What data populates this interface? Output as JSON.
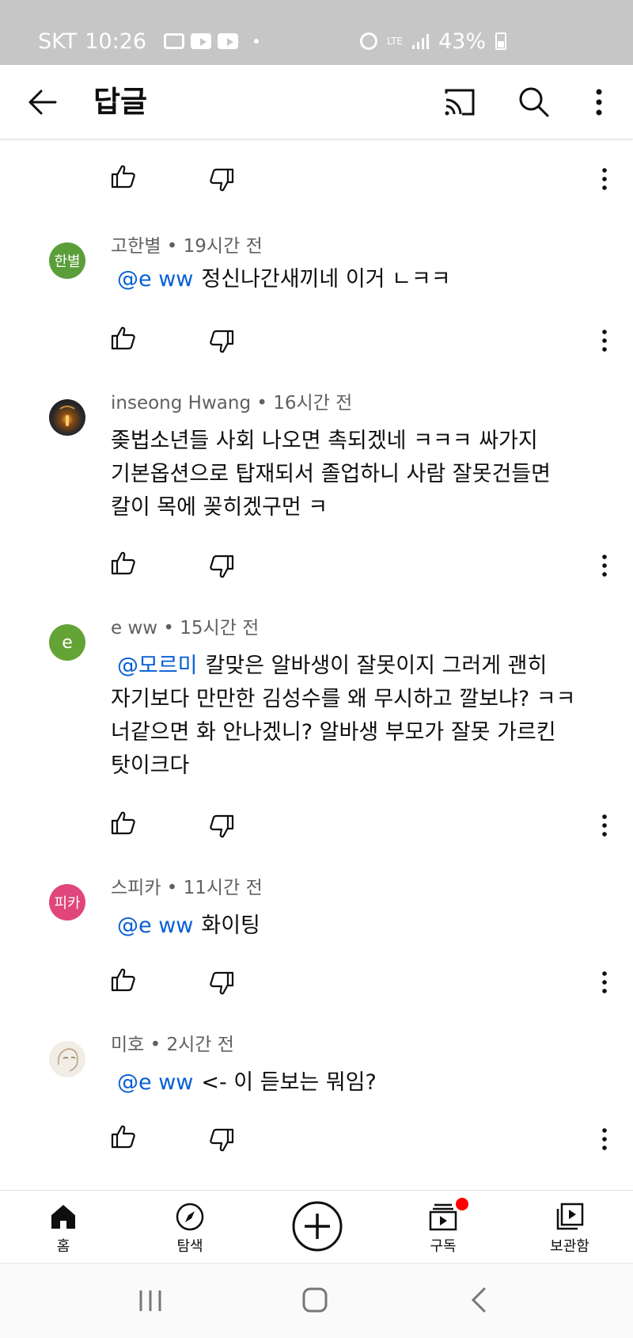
{
  "status_bar": {
    "carrier": "SKT",
    "time": "10:26",
    "network": "LTE",
    "battery": "43%"
  },
  "header": {
    "title": "답글"
  },
  "comments": [
    {
      "avatar_text": "한별",
      "avatar_color": "#5a9e3a",
      "meta": "고한별 • 19시간 전",
      "mention": "@e ww",
      "text": "정신나간새끼네 이거 ㄴㅋㅋ"
    },
    {
      "avatar_text": "",
      "avatar_color": "#2a2a2a",
      "meta": "inseong Hwang • 16시간 전",
      "mention": "",
      "lines": [
        "좆법소년들 사회 나오면 촉되겠네 ㅋㅋㅋ 싸가지",
        "기본옵션으로 탑재되서 졸업하니 사람 잘못건들면",
        "칼이 목에 꽂히겠구먼 ㅋ"
      ]
    },
    {
      "avatar_text": "e",
      "avatar_color": "#64a335",
      "meta": "e ww • 15시간 전",
      "mention": "@모르미",
      "lines": [
        "칼맞은 알바생이 잘못이지 그러게 괜히",
        "자기보다 만만한 김성수를 왜 무시하고 깔보냐? ㅋㅋ",
        "너같으면 화 안나겠니? 알바생 부모가 잘못 가르킨",
        "탓이크다"
      ]
    },
    {
      "avatar_text": "피카",
      "avatar_color": "#e0457b",
      "meta": "스피카 • 11시간 전",
      "mention": "@e ww",
      "text": "화이팅"
    },
    {
      "avatar_text": "",
      "avatar_color": "#f1ede6",
      "meta": "미호 • 2시간 전",
      "mention": "@e ww",
      "text": "<- 이 듣보는 뭐임?"
    }
  ],
  "bottom_nav": {
    "home": "홈",
    "explore": "탐색",
    "subscriptions": "구독",
    "library": "보관함"
  },
  "colors": {
    "mention": "#065fd4",
    "meta": "#606060",
    "notification": "#ff0000"
  }
}
